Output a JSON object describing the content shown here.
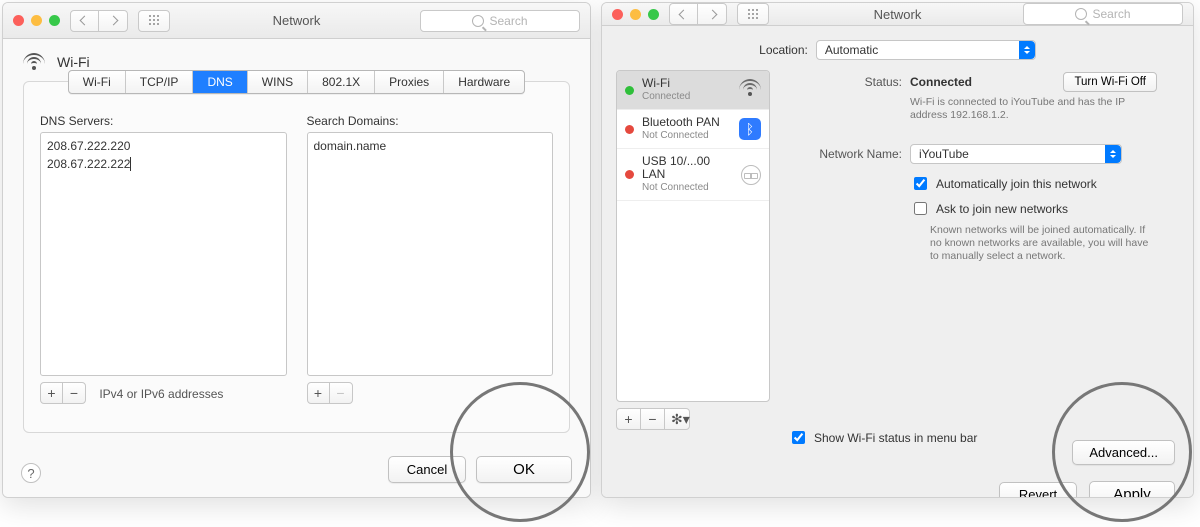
{
  "left_window": {
    "title": "Network",
    "search_placeholder": "Search",
    "header_service": "Wi-Fi",
    "tabs": [
      "Wi-Fi",
      "TCP/IP",
      "DNS",
      "WINS",
      "802.1X",
      "Proxies",
      "Hardware"
    ],
    "tab_selected_index": 2,
    "dns_label": "DNS Servers:",
    "dns_servers": [
      "208.67.222.220",
      "208.67.222.222"
    ],
    "dns_hint": "IPv4 or IPv6 addresses",
    "search_domains_label": "Search Domains:",
    "search_domains": [
      "domain.name"
    ],
    "cancel": "Cancel",
    "ok": "OK"
  },
  "right_window": {
    "title": "Network",
    "search_placeholder": "Search",
    "location_label": "Location:",
    "location_value": "Automatic",
    "services": [
      {
        "name": "Wi-Fi",
        "status": "Connected",
        "dot": "green",
        "icon": "wifi",
        "selected": true
      },
      {
        "name": "Bluetooth PAN",
        "status": "Not Connected",
        "dot": "red",
        "icon": "bt",
        "selected": false
      },
      {
        "name": "USB 10/...00 LAN",
        "status": "Not Connected",
        "dot": "red",
        "icon": "eth",
        "selected": false
      }
    ],
    "status_label": "Status:",
    "status_value": "Connected",
    "status_detail": "Wi-Fi is connected to iYouTube and has the IP address 192.168.1.2.",
    "turn_off": "Turn Wi-Fi Off",
    "network_name_label": "Network Name:",
    "network_name_value": "iYouTube",
    "auto_join": "Automatically join this network",
    "auto_join_checked": true,
    "ask_join": "Ask to join new networks",
    "ask_join_checked": false,
    "ask_join_hint": "Known networks will be joined automatically. If no known networks are available, you will have to manually select a network.",
    "show_menubar": "Show Wi-Fi status in menu bar",
    "show_menubar_checked": true,
    "advanced": "Advanced...",
    "revert": "Revert",
    "apply": "Apply"
  }
}
